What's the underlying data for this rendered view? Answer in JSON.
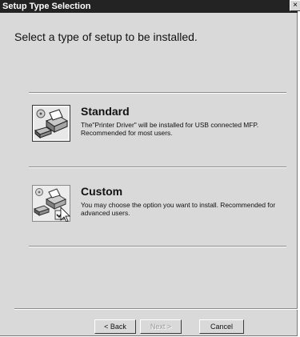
{
  "window": {
    "title": "Setup Type Selection",
    "close_glyph": "×"
  },
  "heading": "Select a type of setup to be installed.",
  "options": [
    {
      "title": "Standard",
      "description": "The\"Printer Driver\" will be installed for USB connected MFP. Recommended for most users.",
      "icon": "printer-setup-icon"
    },
    {
      "title": "Custom",
      "description": "You may choose the option you want to install. Recommended for advanced users.",
      "icon": "printer-custom-setup-icon"
    }
  ],
  "buttons": {
    "back": "< Back",
    "next": "Next >",
    "cancel": "Cancel"
  },
  "colors": {
    "titlebar": "#232323",
    "window_bg": "#d9d9d9"
  }
}
